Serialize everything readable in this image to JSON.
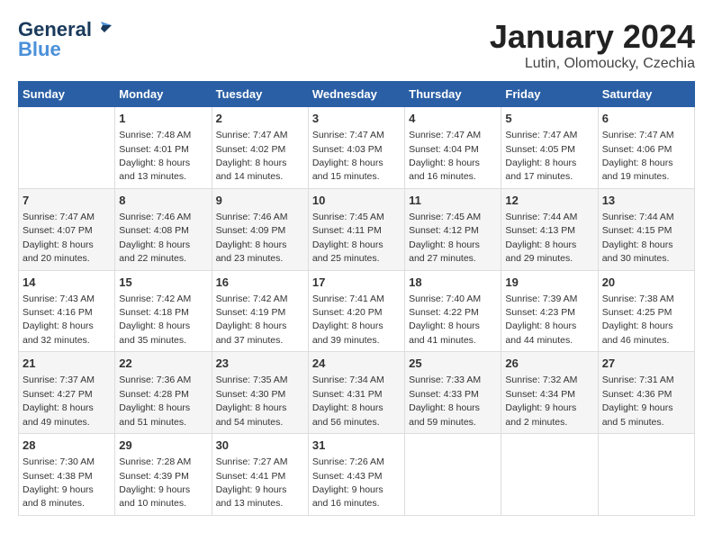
{
  "logo": {
    "line1": "General",
    "line2": "Blue"
  },
  "title": "January 2024",
  "subtitle": "Lutin, Olomoucky, Czechia",
  "days_header": [
    "Sunday",
    "Monday",
    "Tuesday",
    "Wednesday",
    "Thursday",
    "Friday",
    "Saturday"
  ],
  "weeks": [
    [
      {
        "day": "",
        "sunrise": "",
        "sunset": "",
        "daylight": ""
      },
      {
        "day": "1",
        "sunrise": "Sunrise: 7:48 AM",
        "sunset": "Sunset: 4:01 PM",
        "daylight": "Daylight: 8 hours and 13 minutes."
      },
      {
        "day": "2",
        "sunrise": "Sunrise: 7:47 AM",
        "sunset": "Sunset: 4:02 PM",
        "daylight": "Daylight: 8 hours and 14 minutes."
      },
      {
        "day": "3",
        "sunrise": "Sunrise: 7:47 AM",
        "sunset": "Sunset: 4:03 PM",
        "daylight": "Daylight: 8 hours and 15 minutes."
      },
      {
        "day": "4",
        "sunrise": "Sunrise: 7:47 AM",
        "sunset": "Sunset: 4:04 PM",
        "daylight": "Daylight: 8 hours and 16 minutes."
      },
      {
        "day": "5",
        "sunrise": "Sunrise: 7:47 AM",
        "sunset": "Sunset: 4:05 PM",
        "daylight": "Daylight: 8 hours and 17 minutes."
      },
      {
        "day": "6",
        "sunrise": "Sunrise: 7:47 AM",
        "sunset": "Sunset: 4:06 PM",
        "daylight": "Daylight: 8 hours and 19 minutes."
      }
    ],
    [
      {
        "day": "7",
        "sunrise": "Sunrise: 7:47 AM",
        "sunset": "Sunset: 4:07 PM",
        "daylight": "Daylight: 8 hours and 20 minutes."
      },
      {
        "day": "8",
        "sunrise": "Sunrise: 7:46 AM",
        "sunset": "Sunset: 4:08 PM",
        "daylight": "Daylight: 8 hours and 22 minutes."
      },
      {
        "day": "9",
        "sunrise": "Sunrise: 7:46 AM",
        "sunset": "Sunset: 4:09 PM",
        "daylight": "Daylight: 8 hours and 23 minutes."
      },
      {
        "day": "10",
        "sunrise": "Sunrise: 7:45 AM",
        "sunset": "Sunset: 4:11 PM",
        "daylight": "Daylight: 8 hours and 25 minutes."
      },
      {
        "day": "11",
        "sunrise": "Sunrise: 7:45 AM",
        "sunset": "Sunset: 4:12 PM",
        "daylight": "Daylight: 8 hours and 27 minutes."
      },
      {
        "day": "12",
        "sunrise": "Sunrise: 7:44 AM",
        "sunset": "Sunset: 4:13 PM",
        "daylight": "Daylight: 8 hours and 29 minutes."
      },
      {
        "day": "13",
        "sunrise": "Sunrise: 7:44 AM",
        "sunset": "Sunset: 4:15 PM",
        "daylight": "Daylight: 8 hours and 30 minutes."
      }
    ],
    [
      {
        "day": "14",
        "sunrise": "Sunrise: 7:43 AM",
        "sunset": "Sunset: 4:16 PM",
        "daylight": "Daylight: 8 hours and 32 minutes."
      },
      {
        "day": "15",
        "sunrise": "Sunrise: 7:42 AM",
        "sunset": "Sunset: 4:18 PM",
        "daylight": "Daylight: 8 hours and 35 minutes."
      },
      {
        "day": "16",
        "sunrise": "Sunrise: 7:42 AM",
        "sunset": "Sunset: 4:19 PM",
        "daylight": "Daylight: 8 hours and 37 minutes."
      },
      {
        "day": "17",
        "sunrise": "Sunrise: 7:41 AM",
        "sunset": "Sunset: 4:20 PM",
        "daylight": "Daylight: 8 hours and 39 minutes."
      },
      {
        "day": "18",
        "sunrise": "Sunrise: 7:40 AM",
        "sunset": "Sunset: 4:22 PM",
        "daylight": "Daylight: 8 hours and 41 minutes."
      },
      {
        "day": "19",
        "sunrise": "Sunrise: 7:39 AM",
        "sunset": "Sunset: 4:23 PM",
        "daylight": "Daylight: 8 hours and 44 minutes."
      },
      {
        "day": "20",
        "sunrise": "Sunrise: 7:38 AM",
        "sunset": "Sunset: 4:25 PM",
        "daylight": "Daylight: 8 hours and 46 minutes."
      }
    ],
    [
      {
        "day": "21",
        "sunrise": "Sunrise: 7:37 AM",
        "sunset": "Sunset: 4:27 PM",
        "daylight": "Daylight: 8 hours and 49 minutes."
      },
      {
        "day": "22",
        "sunrise": "Sunrise: 7:36 AM",
        "sunset": "Sunset: 4:28 PM",
        "daylight": "Daylight: 8 hours and 51 minutes."
      },
      {
        "day": "23",
        "sunrise": "Sunrise: 7:35 AM",
        "sunset": "Sunset: 4:30 PM",
        "daylight": "Daylight: 8 hours and 54 minutes."
      },
      {
        "day": "24",
        "sunrise": "Sunrise: 7:34 AM",
        "sunset": "Sunset: 4:31 PM",
        "daylight": "Daylight: 8 hours and 56 minutes."
      },
      {
        "day": "25",
        "sunrise": "Sunrise: 7:33 AM",
        "sunset": "Sunset: 4:33 PM",
        "daylight": "Daylight: 8 hours and 59 minutes."
      },
      {
        "day": "26",
        "sunrise": "Sunrise: 7:32 AM",
        "sunset": "Sunset: 4:34 PM",
        "daylight": "Daylight: 9 hours and 2 minutes."
      },
      {
        "day": "27",
        "sunrise": "Sunrise: 7:31 AM",
        "sunset": "Sunset: 4:36 PM",
        "daylight": "Daylight: 9 hours and 5 minutes."
      }
    ],
    [
      {
        "day": "28",
        "sunrise": "Sunrise: 7:30 AM",
        "sunset": "Sunset: 4:38 PM",
        "daylight": "Daylight: 9 hours and 8 minutes."
      },
      {
        "day": "29",
        "sunrise": "Sunrise: 7:28 AM",
        "sunset": "Sunset: 4:39 PM",
        "daylight": "Daylight: 9 hours and 10 minutes."
      },
      {
        "day": "30",
        "sunrise": "Sunrise: 7:27 AM",
        "sunset": "Sunset: 4:41 PM",
        "daylight": "Daylight: 9 hours and 13 minutes."
      },
      {
        "day": "31",
        "sunrise": "Sunrise: 7:26 AM",
        "sunset": "Sunset: 4:43 PM",
        "daylight": "Daylight: 9 hours and 16 minutes."
      },
      {
        "day": "",
        "sunrise": "",
        "sunset": "",
        "daylight": ""
      },
      {
        "day": "",
        "sunrise": "",
        "sunset": "",
        "daylight": ""
      },
      {
        "day": "",
        "sunrise": "",
        "sunset": "",
        "daylight": ""
      }
    ]
  ]
}
